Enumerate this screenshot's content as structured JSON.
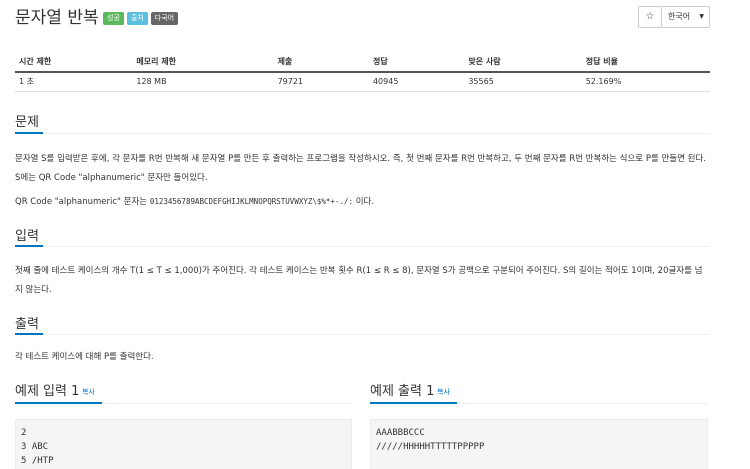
{
  "problem": {
    "title": "문자열 반복",
    "badges": [
      "성공",
      "출처",
      "다국어"
    ]
  },
  "toolbar": {
    "star": "☆",
    "language": "한국어"
  },
  "stats": {
    "headers": [
      "시간 제한",
      "메모리 제한",
      "제출",
      "정답",
      "맞은 사람",
      "정답 비율"
    ],
    "values": [
      "1 초",
      "128 MB",
      "79721",
      "40945",
      "35565",
      "52.169%"
    ]
  },
  "description": {
    "heading": "문제",
    "paragraph1": "문자열 S를 입력받은 후에, 각 문자를 R번 반복해 새 문자열 P를 만든 후 출력하는 프로그램을 작성하시오. 즉, 첫 번째 문자를 R번 반복하고, 두 번째 문자를 R번 반복하는 식으로 P를 만들면 된다. S에는 QR Code \"alphanumeric\" 문자만 들어있다.",
    "paragraph2_prefix": "QR Code \"alphanumeric\" 문자는",
    "paragraph2_code": "0123456789ABCDEFGHIJKLMNOPQRSTUVWXYZ\\$%*+-./:",
    "paragraph2_suffix": "이다."
  },
  "input_section": {
    "heading": "입력",
    "text": "첫째 줄에 테스트 케이스의 개수 T(1 ≤ T ≤ 1,000)가 주어진다. 각 테스트 케이스는 반복 횟수 R(1 ≤ R ≤ 8), 문자열 S가 공백으로 구분되어 주어진다. S의 길이는 적어도 1이며, 20글자를 넘지 않는다."
  },
  "output_section": {
    "heading": "출력",
    "text": "각 테스트 케이스에 대해 P를 출력한다."
  },
  "samples": {
    "input": {
      "title": "예제 입력 1",
      "copy": "복사",
      "lines": [
        "2",
        "3 ABC",
        "5 /HTP"
      ]
    },
    "output": {
      "title": "예제 출력 1",
      "copy": "복사",
      "lines": [
        "AAABBBCCC",
        "/////HHHHHTTTTTPPPPP"
      ]
    }
  }
}
